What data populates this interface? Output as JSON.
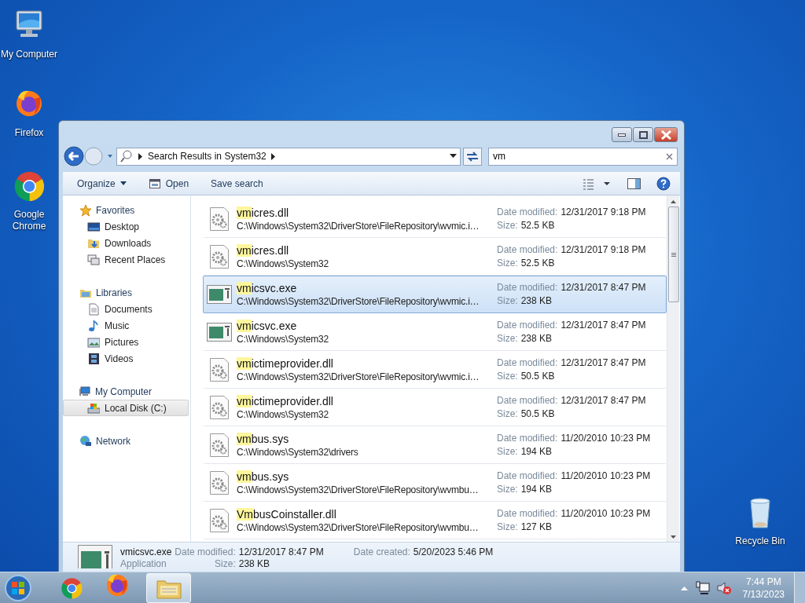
{
  "desktop_icons": [
    {
      "kind": "computer",
      "label": "My Computer"
    },
    {
      "kind": "firefox",
      "label": "Firefox"
    },
    {
      "kind": "chrome",
      "label": "Google Chrome"
    },
    {
      "kind": "recycle",
      "label": "Recycle Bin"
    }
  ],
  "explorer": {
    "address": {
      "crumb": "Search Results in System32"
    },
    "search": {
      "value": "vm"
    },
    "toolbar": [
      {
        "kind": "menu",
        "label": "Organize"
      },
      {
        "kind": "open",
        "label": "Open"
      },
      {
        "kind": "plain",
        "label": "Save search"
      }
    ],
    "nav": [
      {
        "label": "Favorites",
        "selected": false,
        "children": [
          {
            "label": "Desktop",
            "selected": false
          },
          {
            "label": "Downloads",
            "selected": false
          },
          {
            "label": "Recent Places",
            "selected": false
          }
        ]
      },
      {
        "label": "Libraries",
        "selected": false,
        "children": [
          {
            "label": "Documents",
            "selected": false
          },
          {
            "label": "Music",
            "selected": false
          },
          {
            "label": "Pictures",
            "selected": false
          },
          {
            "label": "Videos",
            "selected": false
          }
        ]
      },
      {
        "label": "My Computer",
        "selected": false,
        "children": [
          {
            "label": "Local Disk (C:)",
            "selected": true
          }
        ]
      },
      {
        "label": "Network",
        "selected": false
      }
    ],
    "results": [
      {
        "kind": "file",
        "match": "vm",
        "rest": "icres.dll",
        "path": "C:\\Windows\\System32\\DriverStore\\FileRepository\\wvmic.i…",
        "date_label": "Date modified:",
        "date": "12/31/2017 9:18 PM",
        "size_label": "Size:",
        "size": "52.5 KB",
        "selected": false
      },
      {
        "kind": "file",
        "match": "vm",
        "rest": "icres.dll",
        "path": "C:\\Windows\\System32",
        "date_label": "Date modified:",
        "date": "12/31/2017 9:18 PM",
        "size_label": "Size:",
        "size": "52.5 KB",
        "selected": false
      },
      {
        "kind": "app",
        "match": "vm",
        "rest": "icsvc.exe",
        "path": "C:\\Windows\\System32\\DriverStore\\FileRepository\\wvmic.i…",
        "date_label": "Date modified:",
        "date": "12/31/2017 8:47 PM",
        "size_label": "Size:",
        "size": "238 KB",
        "selected": true
      },
      {
        "kind": "app",
        "match": "vm",
        "rest": "icsvc.exe",
        "path": "C:\\Windows\\System32",
        "date_label": "Date modified:",
        "date": "12/31/2017 8:47 PM",
        "size_label": "Size:",
        "size": "238 KB",
        "selected": false
      },
      {
        "kind": "file",
        "match": "vm",
        "rest": "ictimeprovider.dll",
        "path": "C:\\Windows\\System32\\DriverStore\\FileRepository\\wvmic.i…",
        "date_label": "Date modified:",
        "date": "12/31/2017 8:47 PM",
        "size_label": "Size:",
        "size": "50.5 KB",
        "selected": false
      },
      {
        "kind": "file",
        "match": "vm",
        "rest": "ictimeprovider.dll",
        "path": "C:\\Windows\\System32",
        "date_label": "Date modified:",
        "date": "12/31/2017 8:47 PM",
        "size_label": "Size:",
        "size": "50.5 KB",
        "selected": false
      },
      {
        "kind": "file",
        "match": "vm",
        "rest": "bus.sys",
        "path": "C:\\Windows\\System32\\drivers",
        "date_label": "Date modified:",
        "date": "11/20/2010 10:23 PM",
        "size_label": "Size:",
        "size": "194 KB",
        "selected": false
      },
      {
        "kind": "file",
        "match": "vm",
        "rest": "bus.sys",
        "path": "C:\\Windows\\System32\\DriverStore\\FileRepository\\wvmbu…",
        "date_label": "Date modified:",
        "date": "11/20/2010 10:23 PM",
        "size_label": "Size:",
        "size": "194 KB",
        "selected": false
      },
      {
        "kind": "file",
        "match": "Vm",
        "rest": "busCoinstaller.dll",
        "path": "C:\\Windows\\System32\\DriverStore\\FileRepository\\wvmbu…",
        "date_label": "Date modified:",
        "date": "11/20/2010 10:23 PM",
        "size_label": "Size:",
        "size": "127 KB",
        "selected": false
      }
    ],
    "details": {
      "name": "vmicsvc.exe",
      "type": "Application",
      "modified_label": "Date modified:",
      "modified": "12/31/2017 8:47 PM",
      "created_label": "Date created:",
      "created": "5/20/2023 5:46 PM",
      "size_label": "Size:",
      "size": "238 KB"
    }
  },
  "taskbar": {
    "apps": [
      {
        "kind": "chrome",
        "selected": false
      },
      {
        "kind": "firefox",
        "selected": false
      },
      {
        "kind": "explorer",
        "selected": true
      }
    ],
    "clock": {
      "time": "7:44 PM",
      "date": "7/13/2023"
    }
  }
}
